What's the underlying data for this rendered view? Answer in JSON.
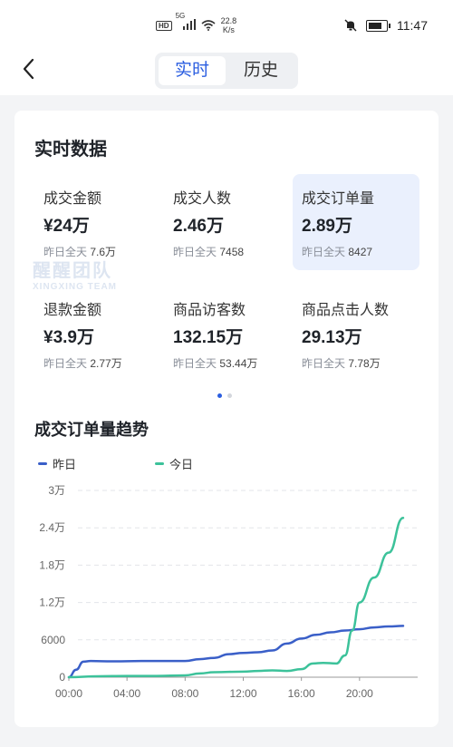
{
  "statusbar": {
    "hd": "HD",
    "net": "5G",
    "speed": "22.8",
    "speed_unit": "K/s",
    "time": "11:47"
  },
  "nav": {
    "tabs": [
      {
        "label": "实时",
        "active": true
      },
      {
        "label": "历史",
        "active": false
      }
    ]
  },
  "section_title": "实时数据",
  "watermark": {
    "line1": "醒醒团队",
    "line2": "XINGXING TEAM"
  },
  "metrics": [
    {
      "label": "成交金额",
      "value": "¥24万",
      "prev_label": "昨日全天",
      "prev_value": "7.6万",
      "selected": false
    },
    {
      "label": "成交人数",
      "value": "2.46万",
      "prev_label": "昨日全天",
      "prev_value": "7458",
      "selected": false
    },
    {
      "label": "成交订单量",
      "value": "2.89万",
      "prev_label": "昨日全天",
      "prev_value": "8427",
      "selected": true
    },
    {
      "label": "退款金额",
      "value": "¥3.9万",
      "prev_label": "昨日全天",
      "prev_value": "2.77万",
      "selected": false
    },
    {
      "label": "商品访客数",
      "value": "132.15万",
      "prev_label": "昨日全天",
      "prev_value": "53.44万",
      "selected": false
    },
    {
      "label": "商品点击人数",
      "value": "29.13万",
      "prev_label": "昨日全天",
      "prev_value": "7.78万",
      "selected": false
    }
  ],
  "pager": {
    "pages": 2,
    "current": 0
  },
  "chart_title": "成交订单量趋势",
  "colors": {
    "accent": "#2b5ee0",
    "yesterday": "#3a5fc8",
    "today": "#3cc29a"
  },
  "chart_data": {
    "type": "line",
    "title": "成交订单量趋势",
    "xlabel": "",
    "ylabel": "",
    "x_ticks": [
      "00:00",
      "04:00",
      "08:00",
      "12:00",
      "16:00",
      "20:00"
    ],
    "y_ticks": [
      "0",
      "6000",
      "1.2万",
      "1.8万",
      "2.4万",
      "3万"
    ],
    "ylim": [
      0,
      30000
    ],
    "xlim": [
      0,
      24
    ],
    "grid": true,
    "legend": "top-left",
    "series": [
      {
        "name": "昨日",
        "color": "#3a5fc8",
        "points": [
          [
            0,
            0
          ],
          [
            0.5,
            1200
          ],
          [
            1,
            2500
          ],
          [
            1.5,
            2600
          ],
          [
            3,
            2550
          ],
          [
            5,
            2600
          ],
          [
            8,
            2600
          ],
          [
            9,
            2900
          ],
          [
            10,
            3100
          ],
          [
            11,
            3700
          ],
          [
            12,
            3900
          ],
          [
            13,
            4000
          ],
          [
            14,
            4300
          ],
          [
            15,
            5400
          ],
          [
            16,
            6200
          ],
          [
            17,
            6800
          ],
          [
            18,
            7200
          ],
          [
            19,
            7500
          ],
          [
            20,
            7700
          ],
          [
            21,
            8000
          ],
          [
            22,
            8150
          ],
          [
            23,
            8250
          ]
        ]
      },
      {
        "name": "今日",
        "color": "#3cc29a",
        "points": [
          [
            0,
            0
          ],
          [
            2,
            150
          ],
          [
            4,
            200
          ],
          [
            6,
            200
          ],
          [
            8,
            300
          ],
          [
            9,
            600
          ],
          [
            10,
            800
          ],
          [
            12,
            900
          ],
          [
            13,
            1000
          ],
          [
            14,
            1100
          ],
          [
            15,
            1000
          ],
          [
            16,
            1300
          ],
          [
            16.8,
            2200
          ],
          [
            17.5,
            2300
          ],
          [
            18.4,
            2200
          ],
          [
            19,
            3500
          ],
          [
            19.5,
            7500
          ],
          [
            20,
            12000
          ],
          [
            21,
            16000
          ],
          [
            22,
            20000
          ],
          [
            23,
            25600
          ]
        ]
      }
    ]
  }
}
